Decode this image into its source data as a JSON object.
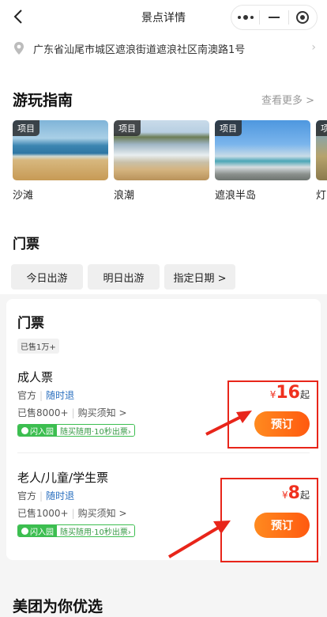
{
  "nav": {
    "title": "景点详情"
  },
  "address": {
    "text": "广东省汕尾市城区遮浪街道遮浪社区南澳路1号"
  },
  "guide": {
    "title": "游玩指南",
    "more": "查看更多 >",
    "cards": [
      {
        "tag": "项目",
        "name": "沙滩"
      },
      {
        "tag": "项目",
        "name": "浪潮"
      },
      {
        "tag": "项目",
        "name": "遮浪半岛"
      },
      {
        "tag": "项",
        "name": "灯"
      }
    ]
  },
  "tickets": {
    "title": "门票",
    "dates": [
      "今日出游",
      "明日出游",
      "指定日期 >"
    ]
  },
  "panel": {
    "title": "门票",
    "sold_badge": "已售1万+",
    "items": [
      {
        "name": "成人票",
        "source": "官方",
        "refund": "随时退",
        "sold": "已售8000+",
        "notice": "购买须知 >",
        "tag_green": "闪入园",
        "tag_white": "随买随用·10秒出票›",
        "currency": "¥",
        "price": "16",
        "suffix": "起",
        "book": "预订"
      },
      {
        "name": "老人/儿童/学生票",
        "source": "官方",
        "refund": "随时退",
        "sold": "已售1000+",
        "notice": "购买须知 >",
        "tag_green": "闪入园",
        "tag_white": "随买随用·10秒出票›",
        "currency": "¥",
        "price": "8",
        "suffix": "起",
        "book": "预订"
      }
    ]
  },
  "bottom": {
    "title": "美团为你优选"
  },
  "colors": {
    "accent": "#ff6a14",
    "price": "#f0301e",
    "annotation": "#e8251a",
    "link": "#2a6fbf",
    "green": "#3cbe50"
  }
}
